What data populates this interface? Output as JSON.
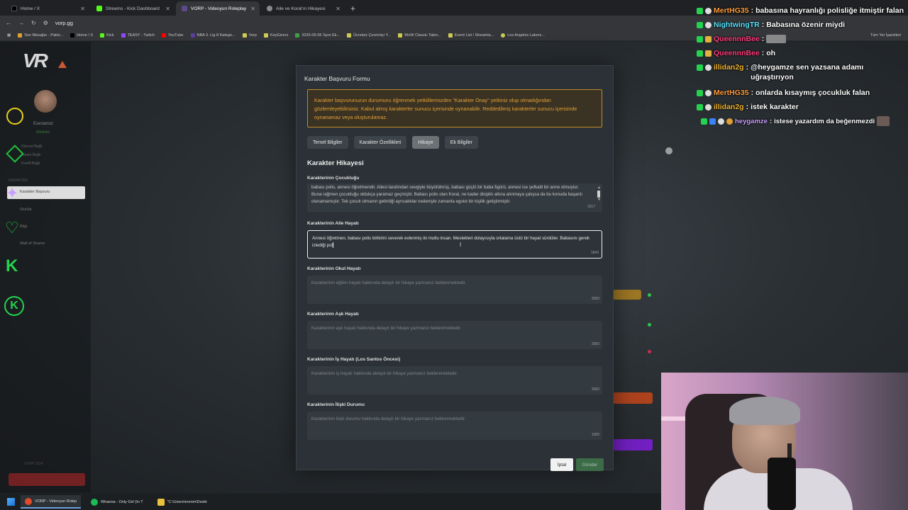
{
  "browser": {
    "tabs": [
      {
        "label": "Home / X",
        "color": "#000000"
      },
      {
        "label": "Streams - Kick Dashboard",
        "color": "#53fc18"
      },
      {
        "label": "VORP - Videoyun Roleplay",
        "color": "#5a4a8a"
      },
      {
        "label": "Aile ve Koral'ın Hikayesi",
        "color": "#8a8a8a"
      }
    ],
    "url": "vorp.gg",
    "bookmarks": [
      {
        "label": "Son Mesajlar - Patici...",
        "color": "#e0a030"
      },
      {
        "label": "Home / X",
        "color": "#000000"
      },
      {
        "label": "Kick",
        "color": "#53fc18"
      },
      {
        "label": "TEASY - Twitch",
        "color": "#9146ff"
      },
      {
        "label": "YouTube",
        "color": "#ff0000"
      },
      {
        "label": "NBA 3. Lig 8 Katego...",
        "color": "#5a3ea0"
      },
      {
        "label": "Vorp",
        "color": "#cccc55"
      },
      {
        "label": "KeyGivers",
        "color": "#cccc55"
      },
      {
        "label": "2025-09-06 Spor Ek...",
        "color": "#3fa04a"
      },
      {
        "label": "Ücretsiz Çevrimiçi Y...",
        "color": "#cccc55"
      },
      {
        "label": "WoW Classic Talen...",
        "color": "#cccc55"
      },
      {
        "label": "Event List / Streamla...",
        "color": "#cccc55"
      },
      {
        "label": "Los Angeles Lakers...",
        "color": "#cccc55"
      }
    ],
    "bookmarks_right": "Tüm Yer İşaretleri"
  },
  "sidebar": {
    "name": "Esestanoz",
    "status": "Whitelist",
    "rows": [
      "Discord  Bağlı",
      "Steam  Bağlı",
      "FiveM  Bağlı"
    ],
    "section": "KARAKTER",
    "items": [
      "Başvuru",
      "Karakter Başvuru",
      "Sözlük",
      "Bilgi",
      "Wall of Shame"
    ],
    "footer": "VORP 2024"
  },
  "modal": {
    "title": "Karakter Başvuru Formu",
    "notice": "Karakter başvurunuzun durumunu öğrenmek yetkililerinizden \"Karakter Onay\" yetkiniz olup olmadığından gözlemleyebilirsiniz. Kabul almış karakterler sunucu içerisinde oynanabilir. Reddedilmiş karakterler sunucu içerisinde oynanamaz veya oluşturulamaz.",
    "tabs": [
      {
        "label": "Temel Bilgiler",
        "active": false
      },
      {
        "label": "Karakter Özellikleri",
        "active": false
      },
      {
        "label": "Hikaye",
        "active": true
      },
      {
        "label": "Ek Bilgiler",
        "active": false
      }
    ],
    "section_title": "Karakter Hikayesi",
    "fields": [
      {
        "label": "Karakterinin Çocukluğu",
        "value": "babası polis, annesi öğretmendir. Ailesi tarafından sevgiyle büyütülmüş, babası güçlü bir baba figürü, annesi ise şefkatli bir anne olmuştur. Buna rağmen çocukluğu oldukça yaramaz geçmiştir. Babası polis olan Koral, ne kadar disiplin altına alınmaya çalışsa da bu konuda başarılı olunamamıştır. Tek çocuk olmanın getirdiği ayrıcalıklar nedeniyle zamanla egoist bir kişilik geliştirmiştir.",
        "count": "1617"
      },
      {
        "label": "Karakterinin Aile Hayatı",
        "value": "Annesi öğretmen, babası polis birbirini severek evlenmiş iki mutlu insan. Meslekleri dolayısıyla ortalama üstü bir hayat sürdüler. Babasını gerek izlediği pol",
        "count": "1842"
      },
      {
        "label": "Karakterinin Okul Hayatı",
        "placeholder": "Karakterinin eğitim hayatı hakkında detaylı bir hikaye yazmanız beklenmektedir.",
        "count": "2000"
      },
      {
        "label": "Karakterinin Aşk Hayatı",
        "placeholder": "Karakterinin aşk hayatı hakkında detaylı bir hikaye yazmanız beklenmektedir.",
        "count": "2000"
      },
      {
        "label": "Karakterinin İş Hayatı (Los Santos Öncesi)",
        "placeholder": "Karakterinin iş hayatı hakkında detaylı bir hikaye yazmanız beklenmektedir.",
        "count": "2000"
      },
      {
        "label": "Karakterinin İlişki Durumu",
        "placeholder": "Karakterinin ilişki durumu hakkında detaylı bir hikaye yazmanız beklenmektedir.",
        "count": "1000"
      }
    ],
    "cancel_label": "İptal",
    "submit_label": "Gönder"
  },
  "chat": [
    {
      "user": "MertHG35",
      "msg": "babasına hayranlığı polisliğe itmiştir falan",
      "color": "#ff9d3c"
    },
    {
      "user": "NightwingTR",
      "msg": "Babasına özenir miydi",
      "color": "#57e6ff"
    },
    {
      "user": "QueennnBee",
      "msg": "",
      "color": "#ff3b7a",
      "emote": true
    },
    {
      "user": "QueennnBee",
      "msg": "oh",
      "color": "#ff3b7a"
    },
    {
      "user": "illidan2g",
      "msg": "@heygamze sen yazsana adamı uğraştırıyon",
      "color": "#f2b431"
    },
    {
      "user": "MertHG35",
      "msg": "onlarda kısaymış çocukluk falan",
      "color": "#ff9d3c"
    },
    {
      "user": "illidan2g",
      "msg": "istek karakter",
      "color": "#f2b431"
    },
    {
      "user": "heygamze",
      "msg": "istese yazardım da beğenmezdi",
      "color": "#c9a0ff",
      "small": true
    }
  ],
  "taskbar": {
    "items": [
      {
        "label": "VORP - Videoyun Rolep",
        "color": "#e04a2a",
        "active": true
      },
      {
        "label": "Rihanna - Only Girl (In T",
        "color": "#1db954",
        "active": false
      },
      {
        "label": "\"C:\\Users\\erenm\\Deskt",
        "color": "#e8c23a",
        "active": false
      }
    ]
  }
}
